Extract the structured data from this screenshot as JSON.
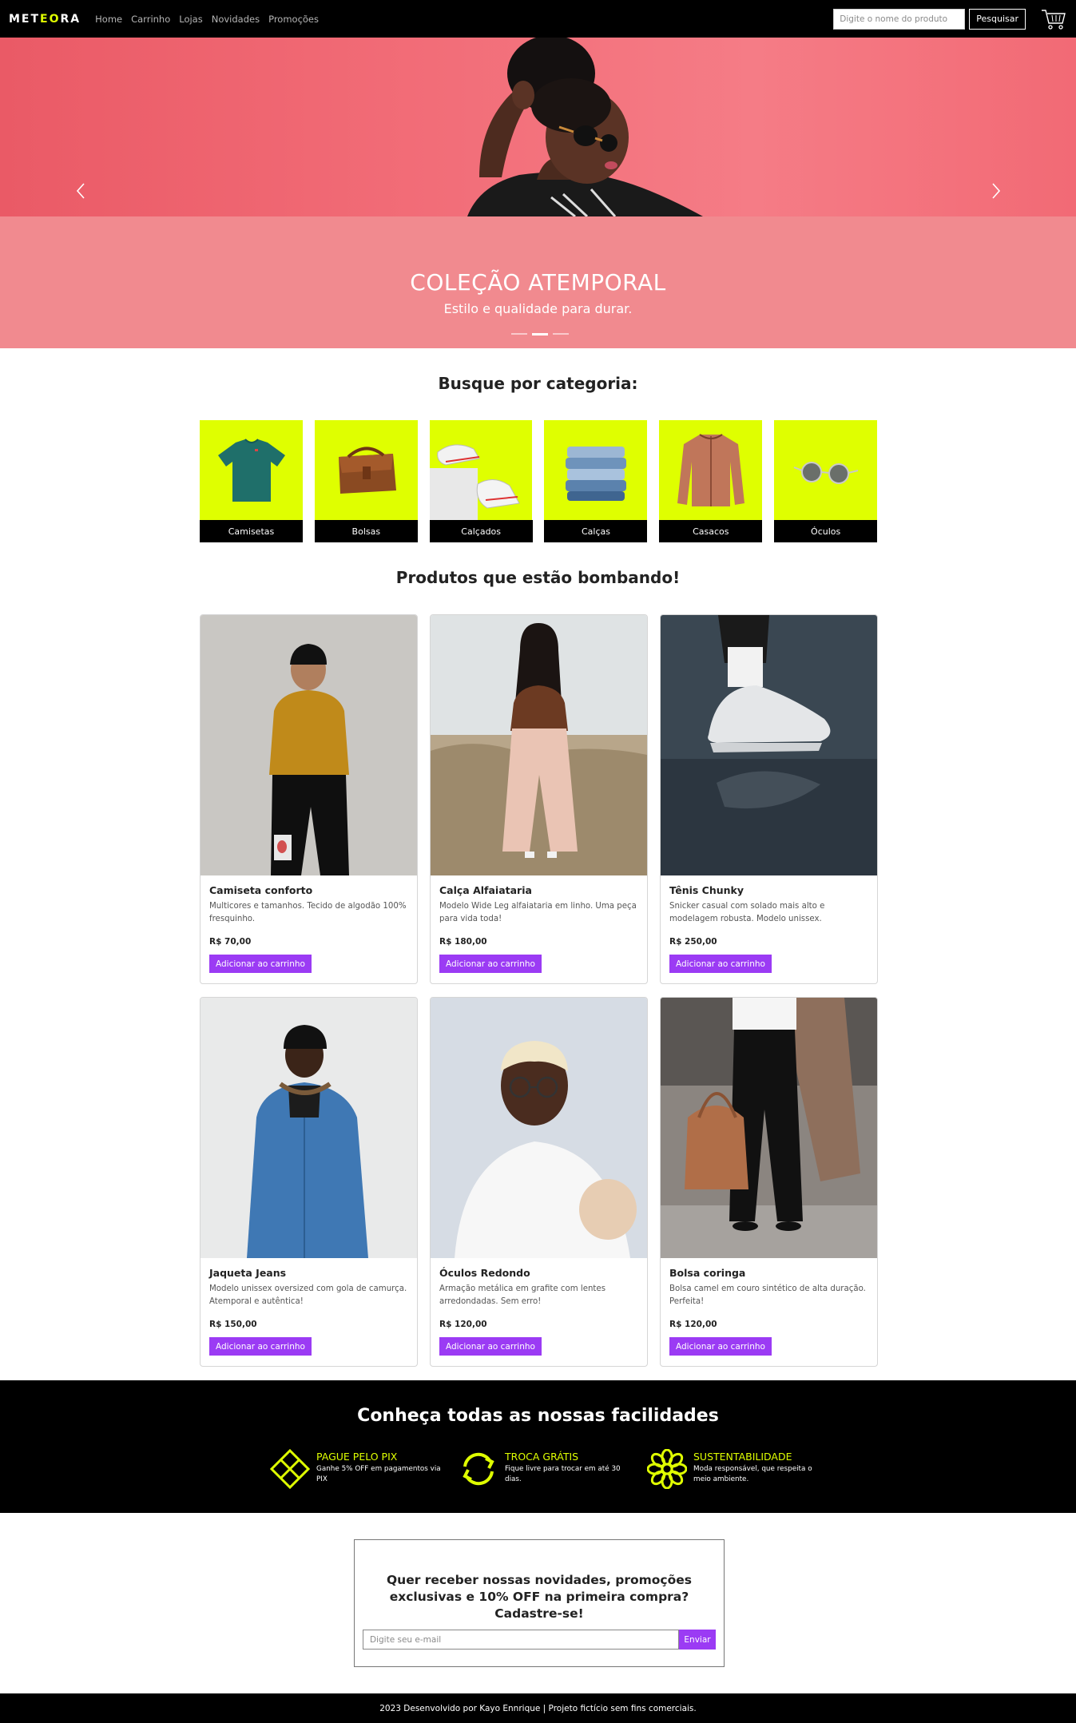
{
  "navbar": {
    "logo": "METEORA",
    "links": [
      "Home",
      "Carrinho",
      "Lojas",
      "Novidades",
      "Promoções"
    ],
    "search_placeholder": "Digite o nome do produto",
    "search_button": "Pesquisar",
    "cart_icon": "cart-icon"
  },
  "hero": {
    "title": "COLEÇÃO ATEMPORAL",
    "subtitle": "Estilo e qualidade para durar.",
    "prev_icon": "chevron-left-icon",
    "next_icon": "chevron-right-icon",
    "slides_count": 3,
    "active_slide": 2
  },
  "categories": {
    "title": "Busque por categoria:",
    "items": [
      {
        "label": "Camisetas",
        "icon": "tshirt-icon"
      },
      {
        "label": "Bolsas",
        "icon": "bag-icon"
      },
      {
        "label": "Calçados",
        "icon": "sneaker-icon"
      },
      {
        "label": "Calças",
        "icon": "jeans-icon"
      },
      {
        "label": "Casacos",
        "icon": "jacket-icon"
      },
      {
        "label": "Óculos",
        "icon": "glasses-icon"
      }
    ]
  },
  "products": {
    "title": "Produtos que estão bombando!",
    "button_label": "Adicionar ao carrinho",
    "items": [
      {
        "name": "Camiseta conforto",
        "description": "Multicores e tamanhos. Tecido de algodão 100% fresquinho.",
        "price": "R$ 70,00"
      },
      {
        "name": "Calça Alfaiataria",
        "description": "Modelo Wide Leg alfaiataria em linho. Uma peça para vida toda!",
        "price": "R$ 180,00"
      },
      {
        "name": "Tênis Chunky",
        "description": "Snicker casual com solado mais alto e modelagem robusta. Modelo unissex.",
        "price": "R$ 250,00"
      },
      {
        "name": "Jaqueta Jeans",
        "description": "Modelo unissex oversized com gola de camurça. Atemporal e autêntica!",
        "price": "R$ 150,00"
      },
      {
        "name": "Óculos Redondo",
        "description": "Armação metálica em grafite com lentes arredondadas. Sem erro!",
        "price": "R$ 120,00"
      },
      {
        "name": "Bolsa coringa",
        "description": "Bolsa camel em couro sintético de alta duração. Perfeita!",
        "price": "R$ 120,00"
      }
    ]
  },
  "features": {
    "title": "Conheça todas as nossas facilidades",
    "items": [
      {
        "title": "PAGUE PELO PIX",
        "description": "Ganhe 5% OFF em pagamentos via PIX",
        "icon": "pix-icon"
      },
      {
        "title": "TROCA GRÁTIS",
        "description": "Fique livre para trocar em até 30 dias.",
        "icon": "exchange-icon"
      },
      {
        "title": "SUSTENTABILIDADE",
        "description": "Moda responsável, que respeita o meio ambiente.",
        "icon": "flower-icon"
      }
    ]
  },
  "newsletter": {
    "text": "Quer receber nossas novidades, promoções exclusivas e 10% OFF na primeira compra? Cadastre-se!",
    "email_placeholder": "Digite seu e-mail",
    "send_button": "Enviar"
  },
  "footer": {
    "text": "2023 Desenvolvido por Kayo Ennrique | Projeto fictício sem fins comerciais."
  },
  "colors": {
    "accent": "#dfff00",
    "button": "#9b3bf4",
    "hero_bg": "#f18a8f",
    "dark": "#000000"
  }
}
